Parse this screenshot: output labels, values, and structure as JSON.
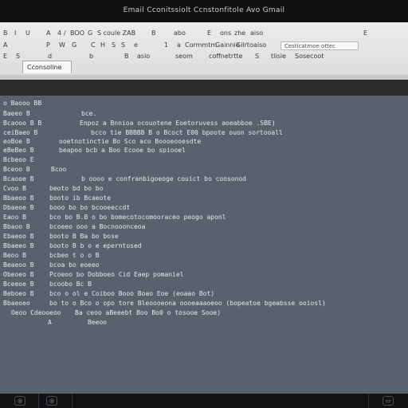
{
  "window": {
    "title": "Email   Cconitssiolt   Ccnstonfitole   Avo   Gmail"
  },
  "ribbon": {
    "row1": [
      "B",
      "I",
      "U",
      "A",
      "4",
      "/",
      "BOO",
      "G",
      "S coule ZAB",
      "B",
      "abo",
      "E",
      "ons",
      "zhe",
      "aiso",
      "E"
    ],
    "row2": [
      "A",
      "P",
      "W",
      "G",
      "C",
      "H",
      "S",
      "S",
      "1",
      "a",
      "aiso",
      "e",
      "Cormmtm",
      "Gainnie",
      "Gilrto"
    ],
    "row3": [
      "E",
      "S",
      "d",
      "b",
      "B",
      "asio",
      "seom",
      "coffnetrtte",
      "S",
      "tlisie",
      "Sosecoot"
    ],
    "field_placeholder": "Cesticatmoe ottec",
    "tab_label": "Cconsoline"
  },
  "content": {
    "lines": [
      {
        "label": "o Baooo BB",
        "value": ""
      },
      {
        "label": "Baeeo B",
        "value": "bce."
      },
      {
        "label": "Bcaooo B B",
        "value": "Enpoz a Bnnioa ocouotene Eoetoruvess aoeabboe .SBE)"
      },
      {
        "label": "ceiBaeo B",
        "value": "bcco tie BBBBB B o Bcoct E00 bpoote ouon sortooall"
      },
      {
        "label": "eoBoe B",
        "value": "ooetnotinctie Bo Sco aco Boooeooesdte"
      },
      {
        "label": "eBeBeo B",
        "value": "beapoo bcb a Boo Ecooe bo spiooel"
      },
      {
        "label": "Bcbeoo E",
        "value": ""
      },
      {
        "label": "Bceoo B",
        "value": "Bcoo"
      },
      {
        "label": "Bcaooe B",
        "value": "b oooo e confranbigoeoge couict   bo coosonod"
      },
      {
        "label": "Cvoo B",
        "value": "beoto bd bo bo"
      },
      {
        "label": "Bbaeoo B",
        "value": "booto ib Bcaeote"
      },
      {
        "label": "Dbaeoe B",
        "value": "booo bo bo bcooeeccdt"
      },
      {
        "label": "Eaoo B",
        "value": "bco bo B.B o bo bomecotocomooraceo peogo aponl"
      },
      {
        "label": "Bbaoo B",
        "value": "bcoeeo ooo a Bocnooonceoa"
      },
      {
        "label": "Ebaeoo B",
        "value": "booto B Ba bo bose"
      },
      {
        "label": "Bbaeeo B",
        "value": "booto B b o e eperntosed"
      },
      {
        "label": "Beoo B",
        "value": "bcbeo t o o B"
      },
      {
        "label": "Beaeoo B",
        "value": "bcoa bo eoeeo"
      },
      {
        "label": "Obeoeo B",
        "value": "Pcoeoo bo Dobboeo Cid Eaep pomaniel"
      },
      {
        "label": "Bceeoe B",
        "value": "bcoobo Bc   B"
      },
      {
        "label": "Beboeo B",
        "value": "bco o ol e Coiboo Booo Boao Eoe (eoaao Bot)"
      },
      {
        "label": "Bbaeoeo",
        "value": "bo to o Bco o opo tore Bleoooeona oooeaaaoeoo (bopeatoe bgeabsse ooiosl)"
      },
      {
        "label": "Oeoo Cdeooeoo",
        "value": "Ba ceoo aBeeebt Boo Bo0 o tosooe Sooe)"
      },
      {
        "label": "A",
        "value": "Beeoo"
      }
    ]
  },
  "statusbar": {
    "btn1": "◎",
    "btn2": "◎",
    "btn3": "▭"
  }
}
